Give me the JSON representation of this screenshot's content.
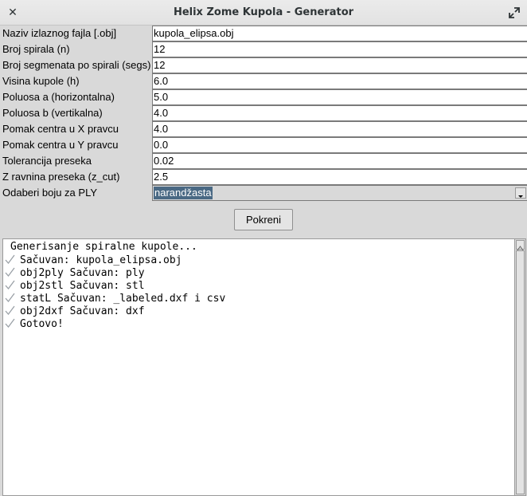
{
  "window": {
    "title": "Helix Zome Kupola - Generator",
    "close_glyph": "✕",
    "maximize_icon": "maximize-icon"
  },
  "form": {
    "fields": [
      {
        "label": "Naziv izlaznog fajla [.obj]",
        "value": "kupola_elipsa.obj"
      },
      {
        "label": "Broj spirala (n)",
        "value": "12"
      },
      {
        "label": "Broj segmenata po spirali (segs)",
        "value": "12"
      },
      {
        "label": "Visina kupole (h)",
        "value": "6.0"
      },
      {
        "label": "Poluosa a (horizontalna)",
        "value": "5.0"
      },
      {
        "label": "Poluosa b (vertikalna)",
        "value": "4.0"
      },
      {
        "label": "Pomak centra u X pravcu",
        "value": "4.0"
      },
      {
        "label": "Pomak centra u Y pravcu",
        "value": "0.0"
      },
      {
        "label": "Tolerancija preseka",
        "value": "0.02"
      },
      {
        "label": "Z ravnina preseka (z_cut)",
        "value": "2.5"
      }
    ],
    "color_select": {
      "label": "Odaberi boju za PLY",
      "selected": "narandžasta"
    },
    "run_button": "Pokreni"
  },
  "output": {
    "lines": [
      {
        "check": false,
        "text": "Generisanje spiralne kupole..."
      },
      {
        "check": true,
        "text": "Sačuvan: kupola_elipsa.obj"
      },
      {
        "check": true,
        "text": "obj2ply Sačuvan: ply"
      },
      {
        "check": true,
        "text": "obj2stl Sačuvan: stl"
      },
      {
        "check": true,
        "text": "statL Sačuvan: _labeled.dxf i csv"
      },
      {
        "check": true,
        "text": "obj2dxf Sačuvan: dxf"
      },
      {
        "check": true,
        "text": "Gotovo!"
      }
    ]
  },
  "colors": {
    "selection_bg": "#4a6984",
    "check_color": "#9aa0a6"
  }
}
